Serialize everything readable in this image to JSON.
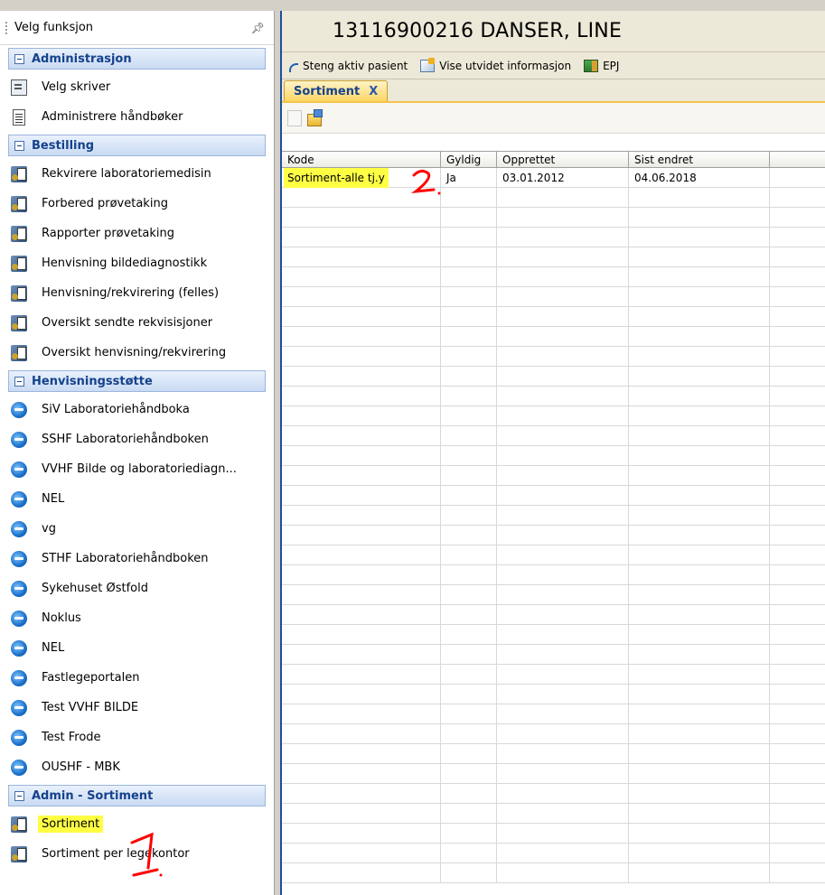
{
  "left_panel": {
    "title": "Velg funksjon",
    "pin_icon": "pin-icon",
    "groups": [
      {
        "label": "Administrasjon",
        "items": [
          {
            "label": "Velg skriver",
            "icon": "printer-icon"
          },
          {
            "label": "Administrere håndbøker",
            "icon": "document-icon"
          }
        ]
      },
      {
        "label": "Bestilling",
        "items": [
          {
            "label": "Rekvirere laboratoriemedisin",
            "icon": "application-icon"
          },
          {
            "label": "Forbered prøvetaking",
            "icon": "application-icon"
          },
          {
            "label": "Rapporter prøvetaking",
            "icon": "application-icon"
          },
          {
            "label": "Henvisning bildediagnostikk",
            "icon": "application-icon"
          },
          {
            "label": "Henvisning/rekvirering (felles)",
            "icon": "application-icon"
          },
          {
            "label": "Oversikt sendte rekvisisjoner",
            "icon": "application-icon"
          },
          {
            "label": "Oversikt henvisning/rekvirering",
            "icon": "application-icon"
          }
        ]
      },
      {
        "label": "Henvisningsstøtte",
        "items": [
          {
            "label": "SiV Laboratoriehåndboka",
            "icon": "internet-explorer-icon"
          },
          {
            "label": "SSHF Laboratoriehåndboken",
            "icon": "internet-explorer-icon"
          },
          {
            "label": "VVHF Bilde og laboratoriediagn...",
            "icon": "internet-explorer-icon"
          },
          {
            "label": "NEL",
            "icon": "internet-explorer-icon"
          },
          {
            "label": "vg",
            "icon": "internet-explorer-icon"
          },
          {
            "label": "STHF Laboratoriehåndboken",
            "icon": "internet-explorer-icon"
          },
          {
            "label": "Sykehuset Østfold",
            "icon": "internet-explorer-icon"
          },
          {
            "label": "Noklus",
            "icon": "internet-explorer-icon"
          },
          {
            "label": "NEL",
            "icon": "internet-explorer-icon"
          },
          {
            "label": "Fastlegeportalen",
            "icon": "internet-explorer-icon"
          },
          {
            "label": "Test VVHF BILDE",
            "icon": "internet-explorer-icon"
          },
          {
            "label": "Test Frode",
            "icon": "internet-explorer-icon"
          },
          {
            "label": "OUSHF - MBK",
            "icon": "internet-explorer-icon"
          }
        ]
      },
      {
        "label": "Admin - Sortiment",
        "items": [
          {
            "label": "Sortiment",
            "icon": "application-icon",
            "highlighted": true
          },
          {
            "label": "Sortiment per legekontor",
            "icon": "application-icon"
          }
        ]
      }
    ]
  },
  "patient": {
    "title": "13116900216 DANSER, LINE"
  },
  "toolbar": {
    "close_patient": "Steng aktiv pasient",
    "extended_info": "Vise utvidet informasjon",
    "epj": "EPJ"
  },
  "tab": {
    "label": "Sortiment",
    "close_glyph": "X"
  },
  "grid": {
    "columns": [
      "Kode",
      "Gyldig",
      "Opprettet",
      "Sist endret",
      ""
    ],
    "rows": [
      {
        "kode": "Sortiment-alle tj.y",
        "gyldig": "Ja",
        "opprettet": "03.01.2012",
        "sist_endret": "04.06.2018"
      }
    ],
    "empty_rows": 35
  },
  "annotations": {
    "marker_1": "1",
    "marker_2": "2"
  },
  "colors": {
    "highlight": "#ffff44",
    "annotation": "#ff0000",
    "group_text": "#15428b",
    "splitter_accent": "#1f4e9a"
  }
}
